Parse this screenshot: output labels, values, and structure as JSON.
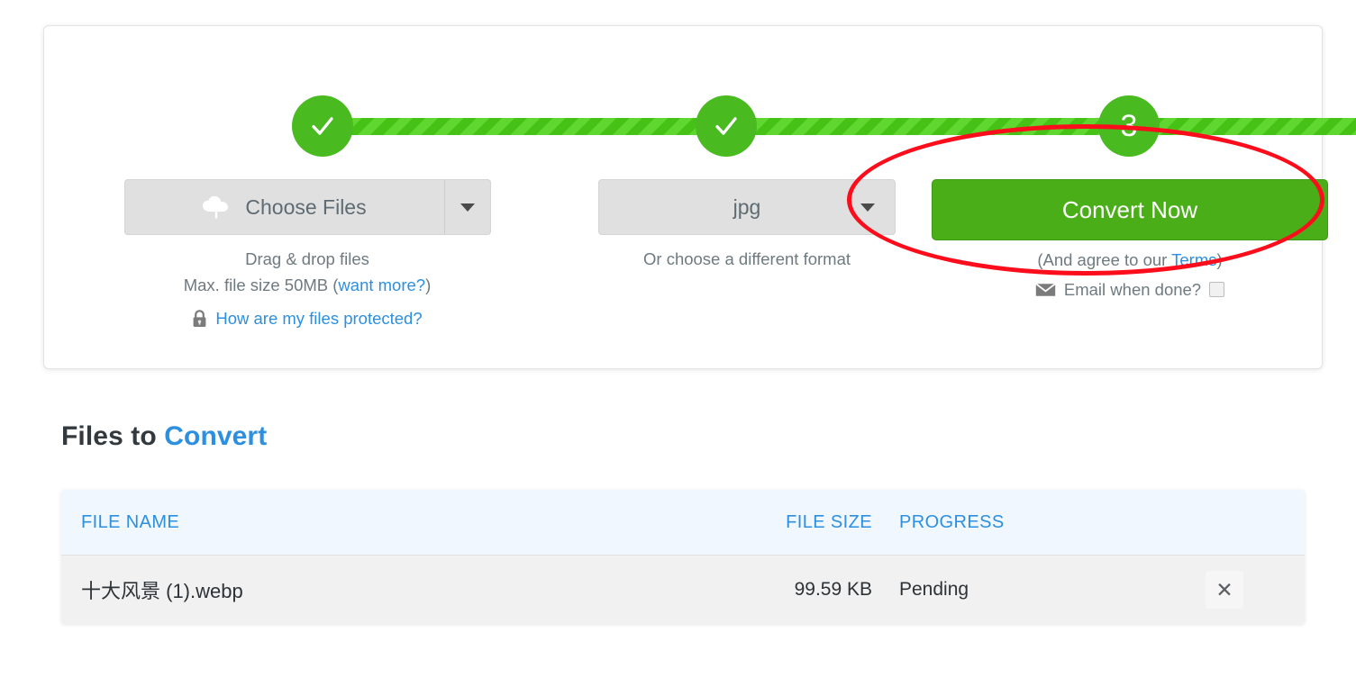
{
  "colors": {
    "green_step": "#4aba21",
    "green_bar": "#4ecb1e",
    "green_button": "#4aae19",
    "link_blue": "#2d8fe0",
    "annotation_red": "#fc0d1b",
    "gray_button": "#e0e0e0"
  },
  "steps": [
    {
      "id": "step-1",
      "state": "complete",
      "icon": "check-icon",
      "label": "✓"
    },
    {
      "id": "step-2",
      "state": "complete",
      "icon": "check-icon",
      "label": "✓"
    },
    {
      "id": "step-3",
      "state": "current",
      "icon": "number",
      "label": "3"
    }
  ],
  "upload": {
    "button_label": "Choose Files",
    "button_icon": "cloud-upload-icon",
    "dropdown_icon": "chevron-down-icon",
    "hint_line1": "Drag & drop files",
    "hint_line2_prefix": "Max. file size 50MB (",
    "hint_line2_link": "want more?",
    "hint_line2_suffix": ")",
    "protected_icon": "lock-icon",
    "protected_link": "How are my files protected?"
  },
  "format": {
    "selected": "jpg",
    "dropdown_icon": "chevron-down-icon",
    "hint": "Or choose a different format"
  },
  "convert": {
    "button_label": "Convert Now",
    "terms_prefix": "(And agree to our ",
    "terms_link": "Terms",
    "terms_suffix": ")",
    "email_icon": "envelope-icon",
    "email_label": "Email when done?",
    "email_checked": false
  },
  "annotation": {
    "shape": "ellipse",
    "target": "convert-now-button",
    "color": "#fc0d1b"
  },
  "files_section": {
    "heading_prefix": "Files to ",
    "heading_accent": "Convert",
    "columns": [
      "FILE NAME",
      "FILE SIZE",
      "PROGRESS"
    ],
    "rows": [
      {
        "name": "十大风景 (1).webp",
        "size": "99.59 KB",
        "progress": "Pending",
        "remove_icon": "close-icon",
        "remove_label": "✕"
      }
    ]
  }
}
